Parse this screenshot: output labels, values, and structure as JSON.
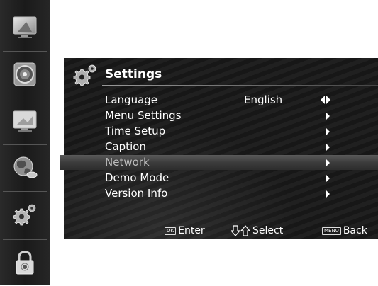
{
  "sidebar": {
    "items": [
      {
        "name": "picture-icon"
      },
      {
        "name": "sound-icon"
      },
      {
        "name": "channel-icon"
      },
      {
        "name": "network-globe-icon"
      },
      {
        "name": "settings-gear-icon"
      },
      {
        "name": "lock-icon"
      }
    ]
  },
  "menu": {
    "title": "Settings",
    "items": [
      {
        "label": "Language",
        "value": "English"
      },
      {
        "label": "Menu Settings",
        "value": ""
      },
      {
        "label": "Time Setup",
        "value": ""
      },
      {
        "label": "Caption",
        "value": ""
      },
      {
        "label": "Network",
        "value": ""
      },
      {
        "label": "Demo Mode",
        "value": ""
      },
      {
        "label": "Version Info",
        "value": ""
      }
    ],
    "selected_index": 4
  },
  "help": {
    "enter_key": "OK",
    "enter_label": "Enter",
    "select_label": "Select",
    "back_key": "MENU",
    "back_label": "Back"
  },
  "colors": {
    "panel_bg": "#1b1b1b",
    "rail_bg": "#222222",
    "highlight": "#4a4a4a",
    "text": "#ffffff"
  }
}
